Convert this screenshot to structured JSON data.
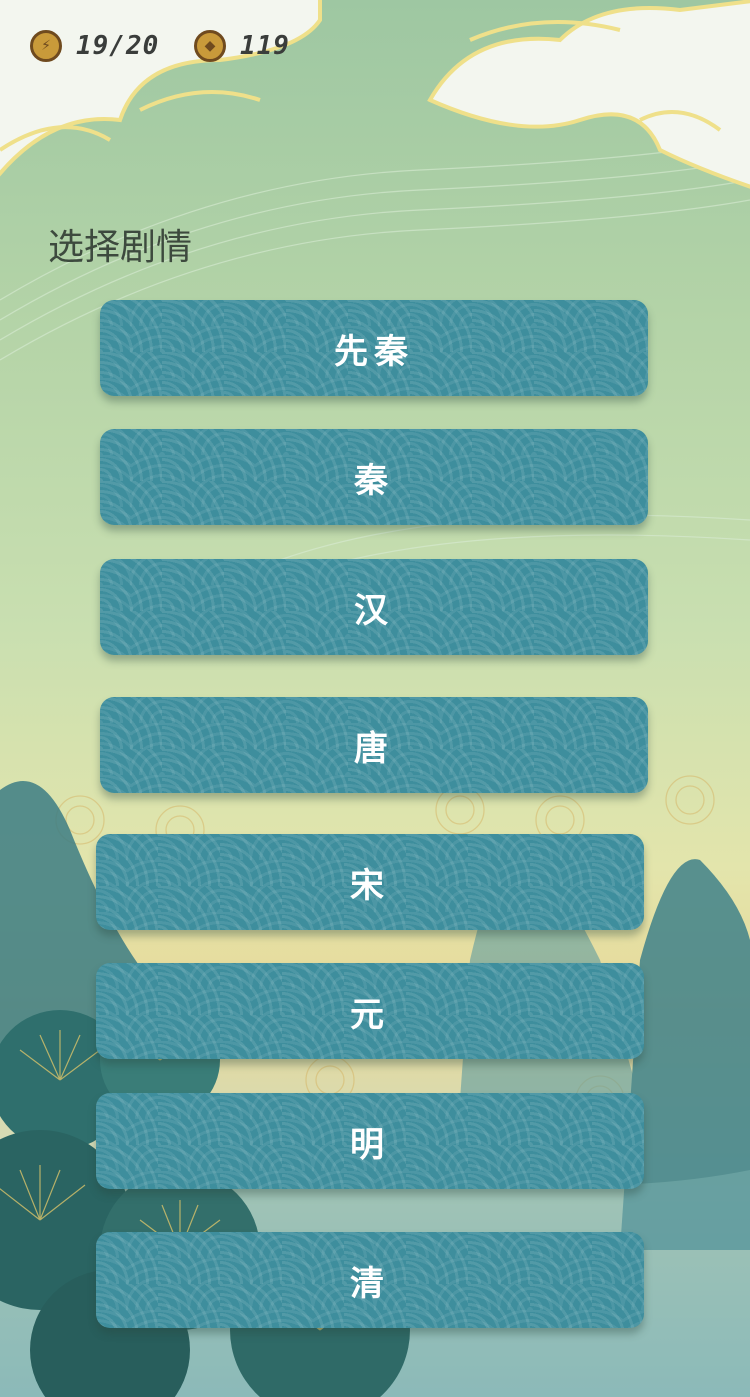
{
  "hud": {
    "energy": {
      "icon": "lightning-coin-icon",
      "value": "19/20"
    },
    "coins": {
      "icon": "diamond-coin-icon",
      "value": "119"
    }
  },
  "title": "选择剧情",
  "eras": [
    {
      "label": "先秦"
    },
    {
      "label": "秦"
    },
    {
      "label": "汉"
    },
    {
      "label": "唐"
    },
    {
      "label": "宋"
    },
    {
      "label": "元"
    },
    {
      "label": "明"
    },
    {
      "label": "清"
    }
  ],
  "colors": {
    "button": "#3e8e9d",
    "cloud_outline": "#f2e58e",
    "mountain": "#2f6f7a"
  }
}
